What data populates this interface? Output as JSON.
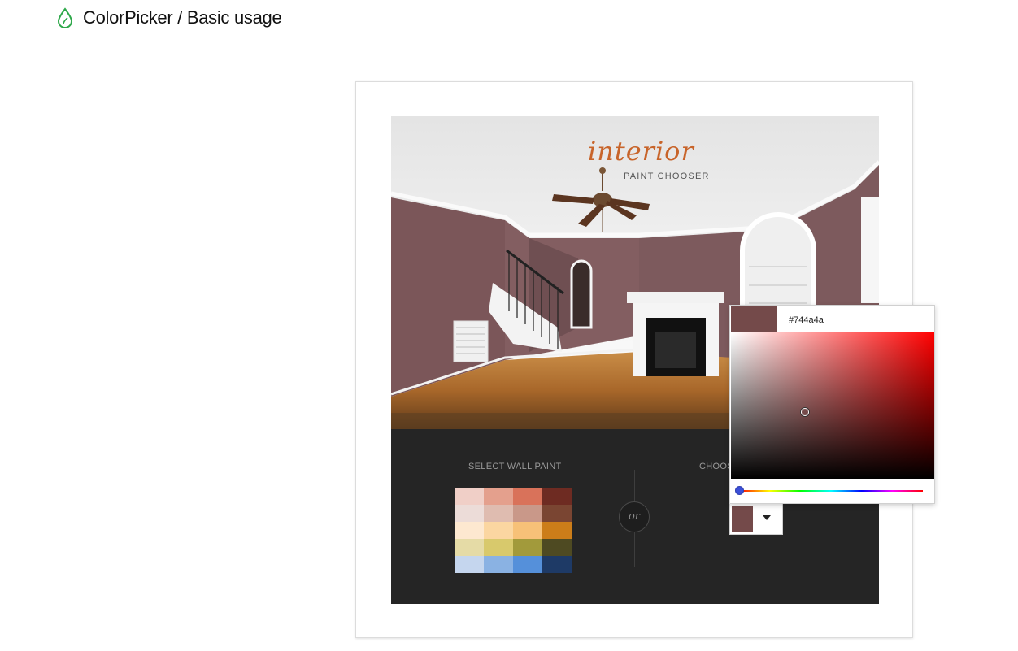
{
  "header": {
    "title": "ColorPicker / Basic usage",
    "logo_icon": "leaf-drop-icon"
  },
  "room": {
    "title_big": "interior",
    "title_small": "PAINT CHOOSER",
    "wall_color": "#744a4a"
  },
  "panel": {
    "select_label": "SELECT WALL PAINT",
    "or_label": "or",
    "choose_label": "CHOOS",
    "swatches": [
      "#f0cfc7",
      "#e4a08d",
      "#d9725a",
      "#6e2b22",
      "#ecdcd8",
      "#dfbcb0",
      "#c99889",
      "#7a4532",
      "#fde8d0",
      "#fbd6a1",
      "#f7c178",
      "#cc7d19",
      "#e5dba6",
      "#d8c96c",
      "#a29a3b",
      "#4e4a22",
      "#c5d6ee",
      "#8ab2e3",
      "#5590da",
      "#1e3a66"
    ]
  },
  "colorpicker": {
    "value": "#744a4a",
    "hue_value": 0,
    "dropdown_icon": "caret-down-icon"
  }
}
